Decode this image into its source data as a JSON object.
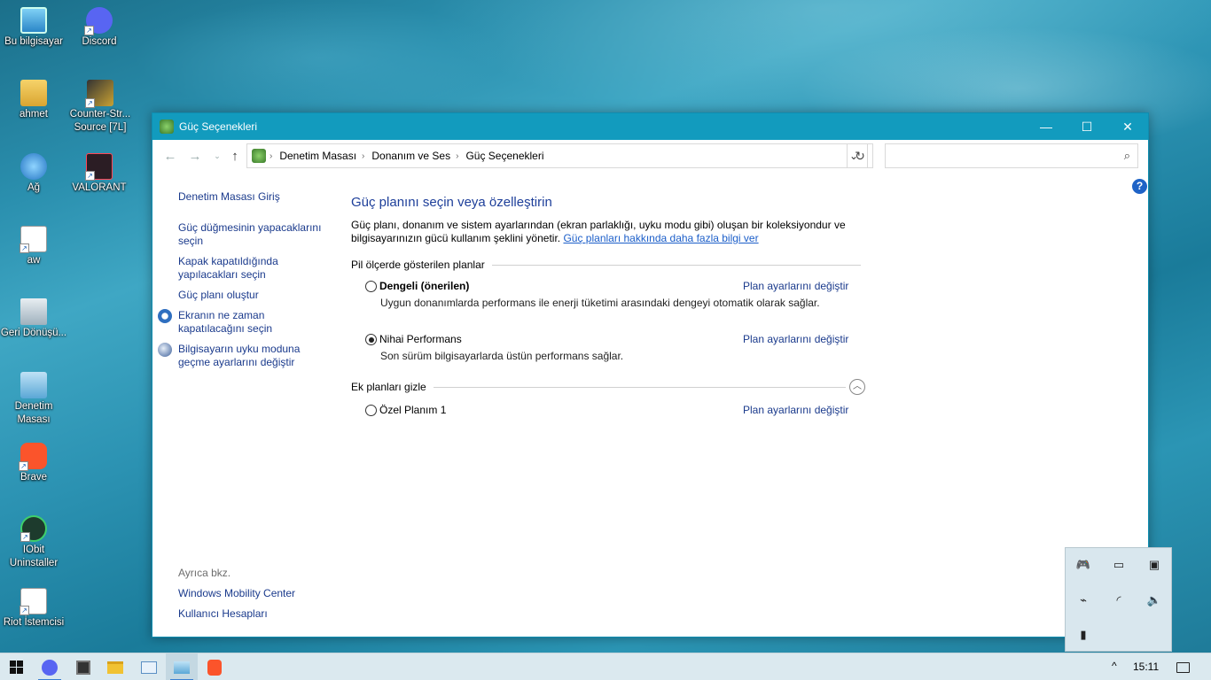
{
  "desktop": {
    "icons": [
      {
        "label": "Bu bilgisayar",
        "icon": "computer-icon"
      },
      {
        "label": "Discord",
        "icon": "discord-icon"
      },
      {
        "label": "ahmet",
        "icon": "user-folder-icon"
      },
      {
        "label": "Counter-Str... Source [7L]",
        "icon": "counter-strike-icon"
      },
      {
        "label": "Ağ",
        "icon": "network-icon"
      },
      {
        "label": "VALORANT",
        "icon": "valorant-icon"
      },
      {
        "label": "aw",
        "icon": "aw-icon"
      },
      {
        "label": "Geri Dönüşü...",
        "icon": "recycle-bin-icon"
      },
      {
        "label": "Denetim Masası",
        "icon": "control-panel-icon"
      },
      {
        "label": "Brave",
        "icon": "brave-icon"
      },
      {
        "label": "IObit Uninstaller",
        "icon": "iobit-icon"
      },
      {
        "label": "Riot İstemcisi",
        "icon": "riot-client-icon"
      }
    ]
  },
  "window": {
    "title": "Güç Seçenekleri",
    "controls": {
      "minimize": "—",
      "maximize": "☐",
      "close": "✕"
    },
    "breadcrumb": [
      "Denetim Masası",
      "Donanım ve Ses",
      "Güç Seçenekleri"
    ],
    "search": {
      "placeholder": ""
    },
    "help": "?",
    "sidebar": {
      "links": [
        "Denetim Masası Giriş",
        "Güç düğmesinin yapacaklarını seçin",
        "Kapak kapatıldığında yapılacakları seçin",
        "Güç planı oluştur",
        "Ekranın ne zaman kapatılacağını seçin",
        "Bilgisayarın uyku moduna geçme ayarlarını değiştir"
      ],
      "see_also": {
        "heading": "Ayrıca bkz.",
        "links": [
          "Windows Mobility Center",
          "Kullanıcı Hesapları"
        ]
      }
    },
    "main": {
      "title": "Güç planını seçin veya özelleştirin",
      "description": "Güç planı, donanım ve sistem ayarlarından (ekran parlaklığı, uyku modu gibi) oluşan bir koleksiyondur ve bilgisayarınızın gücü kullanım şeklini yönetir.",
      "description_link": "Güç planları hakkında daha fazla bilgi ver",
      "section_battery": "Pil ölçerde gösterilen planlar",
      "plans": [
        {
          "name": "Dengeli (önerilen)",
          "desc": "Uygun donanımlarda performans ile enerji tüketimi arasındaki dengeyi otomatik olarak sağlar.",
          "change": "Plan ayarlarını değiştir",
          "selected": false
        },
        {
          "name": "Nihai Performans",
          "desc": "Son sürüm bilgisayarlarda üstün performans sağlar.",
          "change": "Plan ayarlarını değiştir",
          "selected": true
        }
      ],
      "section_extra": "Ek planları gizle",
      "extra_plans": [
        {
          "name": "Özel Planım 1",
          "change": "Plan ayarlarını değiştir",
          "selected": false
        }
      ]
    }
  },
  "taskbar": {
    "time": "15:11",
    "tray_chevron": "^"
  },
  "colors": {
    "titlebar": "#129bbe",
    "link": "#1a3a8c",
    "heading": "#1e3f9a"
  }
}
